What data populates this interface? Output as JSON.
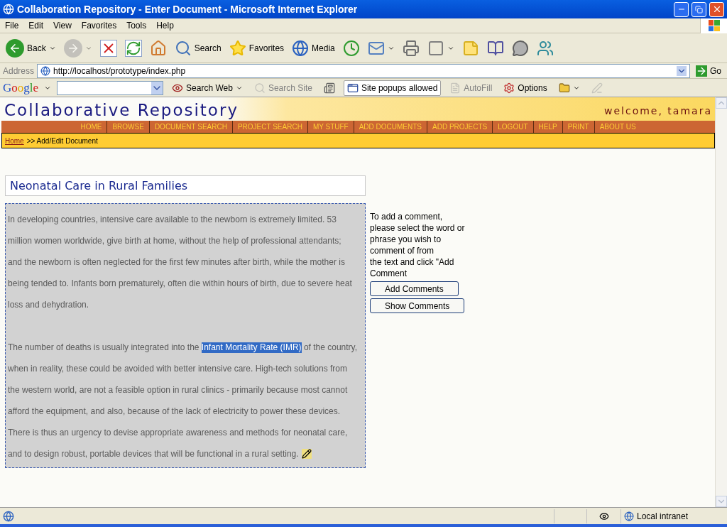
{
  "window": {
    "title": "Collaboration Repository - Enter Document - Microsoft Internet Explorer"
  },
  "menu": [
    "File",
    "Edit",
    "View",
    "Favorites",
    "Tools",
    "Help"
  ],
  "toolbar": [
    {
      "kind": "back",
      "label": "Back",
      "dropdown": true,
      "disabled": false
    },
    {
      "kind": "forward",
      "dropdown": true,
      "disabled": true
    },
    {
      "kind": "stop",
      "dropdown": false,
      "disabled": false
    },
    {
      "kind": "refresh",
      "dropdown": false,
      "disabled": false
    },
    {
      "kind": "home",
      "dropdown": false,
      "disabled": false
    },
    {
      "kind": "search",
      "label": "Search",
      "dropdown": false,
      "disabled": false
    },
    {
      "kind": "favorites",
      "label": "Favorites",
      "dropdown": false,
      "disabled": false
    },
    {
      "kind": "media",
      "label": "Media",
      "dropdown": false,
      "disabled": false
    },
    {
      "kind": "history",
      "dropdown": false,
      "disabled": false
    },
    {
      "kind": "mail",
      "dropdown": true,
      "disabled": false
    },
    {
      "kind": "print",
      "dropdown": false,
      "disabled": false
    },
    {
      "kind": "edit",
      "dropdown": true,
      "disabled": false
    },
    {
      "kind": "note",
      "dropdown": false,
      "disabled": false
    },
    {
      "kind": "research",
      "dropdown": false,
      "disabled": false
    },
    {
      "kind": "discuss",
      "dropdown": false,
      "disabled": false
    },
    {
      "kind": "messenger",
      "dropdown": false,
      "disabled": false
    }
  ],
  "address": {
    "label": "Address",
    "url": "http://localhost/prototype/index.php",
    "go": "Go"
  },
  "google_bar": {
    "logo": "Google",
    "items": [
      {
        "kind": "search_web",
        "label": "Search Web",
        "disabled": false,
        "dropdown": true
      },
      {
        "kind": "search_site",
        "label": "Search Site",
        "disabled": true,
        "dropdown": false
      },
      {
        "kind": "news",
        "disabled": false,
        "dropdown": false
      },
      {
        "kind": "popups",
        "label": "Site popups allowed",
        "disabled": false,
        "dropdown": false
      },
      {
        "kind": "autofill",
        "label": "AutoFill",
        "disabled": true,
        "dropdown": false
      },
      {
        "kind": "options",
        "label": "Options",
        "disabled": false,
        "dropdown": false
      },
      {
        "kind": "folder",
        "disabled": false,
        "dropdown": true
      },
      {
        "kind": "pen",
        "disabled": true,
        "dropdown": false
      }
    ]
  },
  "site": {
    "title": "Collaborative Repository",
    "welcome": "welcome, tamara",
    "nav": [
      "HOME",
      "BROWSE",
      "DOCUMENT SEARCH",
      "PROJECT SEARCH",
      "MY STUFF",
      "ADD DOCUMENTS",
      "ADD PROJECTS",
      "LOGOUT",
      "HELP",
      "PRINT",
      "ABOUT US"
    ],
    "breadcrumb": {
      "link": "Home",
      "rest": ">> Add/Edit Document"
    }
  },
  "document": {
    "title": "Neonatal Care in Rural Families",
    "paragraphs": [
      [
        [
          {
            "text": "In developing countries, intensive care available to the newborn is extremely limited. 53",
            "selected": false
          }
        ],
        [
          {
            "text": "million women worldwide, give birth at home, without the help of professional attendants;",
            "selected": false
          }
        ],
        [
          {
            "text": "and the newborn is often neglected for the first few minutes after birth, while the mother is",
            "selected": false
          }
        ],
        [
          {
            "text": "being tended to. Infants born prematurely, often die within hours of birth, due to severe heat",
            "selected": false
          }
        ],
        [
          {
            "text": "loss and dehydration.",
            "selected": false
          }
        ]
      ],
      [
        [
          {
            "text": "The number of deaths is usually integrated into the ",
            "selected": false
          },
          {
            "text": "Infant Mortality Rate (IMR)",
            "selected": true
          },
          {
            "text": " of the country,",
            "selected": false
          }
        ],
        [
          {
            "text": "when in reality, these could be avoided with better intensive care. High-tech solutions from",
            "selected": false
          }
        ],
        [
          {
            "text": "the western world, are not a feasible option in rural clinics - primarily because most cannot",
            "selected": false
          }
        ],
        [
          {
            "text": "afford the equipment, and also, because of the lack of electricity to power these devices.",
            "selected": false
          }
        ],
        [
          {
            "text": "There is thus an urgency to devise appropriate awareness and methods for neonatal care,",
            "selected": false
          }
        ],
        [
          {
            "text": "and to design robust, portable devices that will be functional in a rural setting.",
            "selected": false
          }
        ]
      ]
    ]
  },
  "comment_panel": {
    "instructions": [
      "To add a comment,",
      "please select the word or",
      "phrase you wish to",
      "comment of from",
      "the text and click \"Add",
      "Comment"
    ],
    "buttons": [
      "Add Comments",
      "Show Comments"
    ]
  },
  "status_bar": {
    "zone": "Local intranet"
  }
}
